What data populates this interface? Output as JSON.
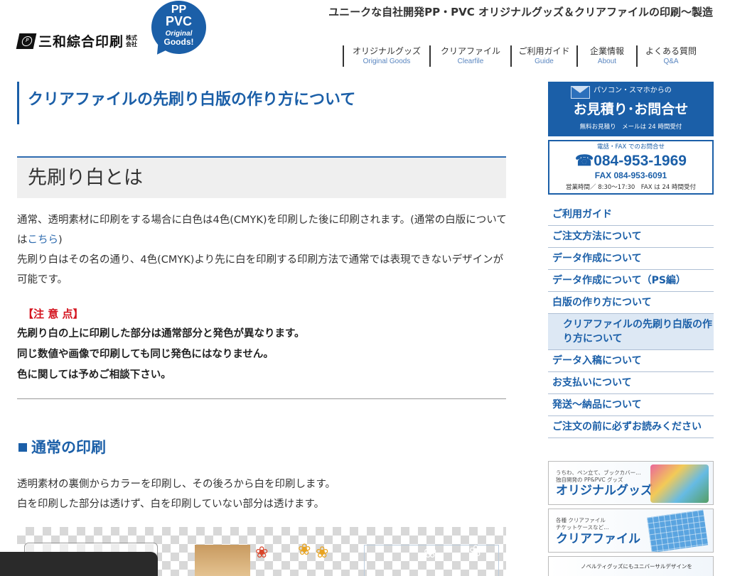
{
  "header": {
    "logo_name": "三和綜合印刷",
    "logo_corp_1": "株式",
    "logo_corp_2": "会社",
    "badge": {
      "l1": "PP",
      "l2": "PVC",
      "l3": "Original",
      "l4": "Goods!"
    },
    "tagline": "ユニークな自社開発PP・PVC オリジナルグッズ＆クリアファイルの印刷～製造"
  },
  "nav": [
    {
      "jp": "オリジナルグッズ",
      "en": "Original Goods"
    },
    {
      "jp": "クリアファイル",
      "en": "Clearfile"
    },
    {
      "jp": "ご利用ガイド",
      "en": "Guide"
    },
    {
      "jp": "企業情報",
      "en": "About"
    },
    {
      "jp": "よくある質問",
      "en": "Q&A"
    }
  ],
  "main": {
    "page_title": "クリアファイルの先刷り白版の作り方について",
    "section_title": "先刷り白とは",
    "intro_1": "通常、透明素材に印刷をする場合に白色は4色(CMYK)を印刷した後に印刷されます。(通常の白版については",
    "intro_link": "こちら",
    "intro_1_end": ")",
    "intro_2": "先刷り白はその名の通り、4色(CMYK)より先に白を印刷する印刷方法で通常では表現できないデザインが可能です。",
    "caution_title": "【注 意 点】",
    "caution_lines": [
      "先刷り白の上に印刷した部分は通常部分と発色が異なります。",
      "同じ数値や画像で印刷しても同じ発色にはなりません。",
      "色に関しては予めご相談下さい。"
    ],
    "normal_title": "通常の印刷",
    "normal_lines": [
      "透明素材の裏側からカラーを印刷し、その後ろから白を印刷します。",
      "白を印刷した部分は透けず、白を印刷していない部分は透けます。"
    ]
  },
  "sidebar": {
    "contact": {
      "line1": "パソコン・スマホからの",
      "line2": "お見積り･お問合せ",
      "line3": "無料お見積り　メールは 24 時間受付"
    },
    "phone": {
      "line1": "電話・FAX でのお問合せ",
      "tel": "☎084-953-1969",
      "fax": "FAX 084-953-6091",
      "hours": "営業時間／ 8:30～17:30　FAX は 24 時間受付"
    },
    "menu": [
      "ご利用ガイド",
      "ご注文方法について",
      "データ作成について",
      "データ作成について（PS編）",
      "白版の作り方について",
      "クリアファイルの先刷り白版の作り方について",
      "データ入稿について",
      "お支払いについて",
      "発送～納品について",
      "ご注文の前に必ずお読みください"
    ],
    "banner1": {
      "small": "うちわ、ペン立て、ブックカバー…\n独自開発の PP&PVC グッズ",
      "big": "オリジナルグッズ"
    },
    "banner2": {
      "small": "各種 クリアファイル\nチケットケースなど…",
      "big": "クリアファイル"
    },
    "banner3": {
      "small": "ノベルティグッズにもユニバーサルデザインを"
    }
  },
  "colors": {
    "brand": "#1b5fa8",
    "caution": "#d4141f",
    "nav_en": "#5a86c0"
  }
}
